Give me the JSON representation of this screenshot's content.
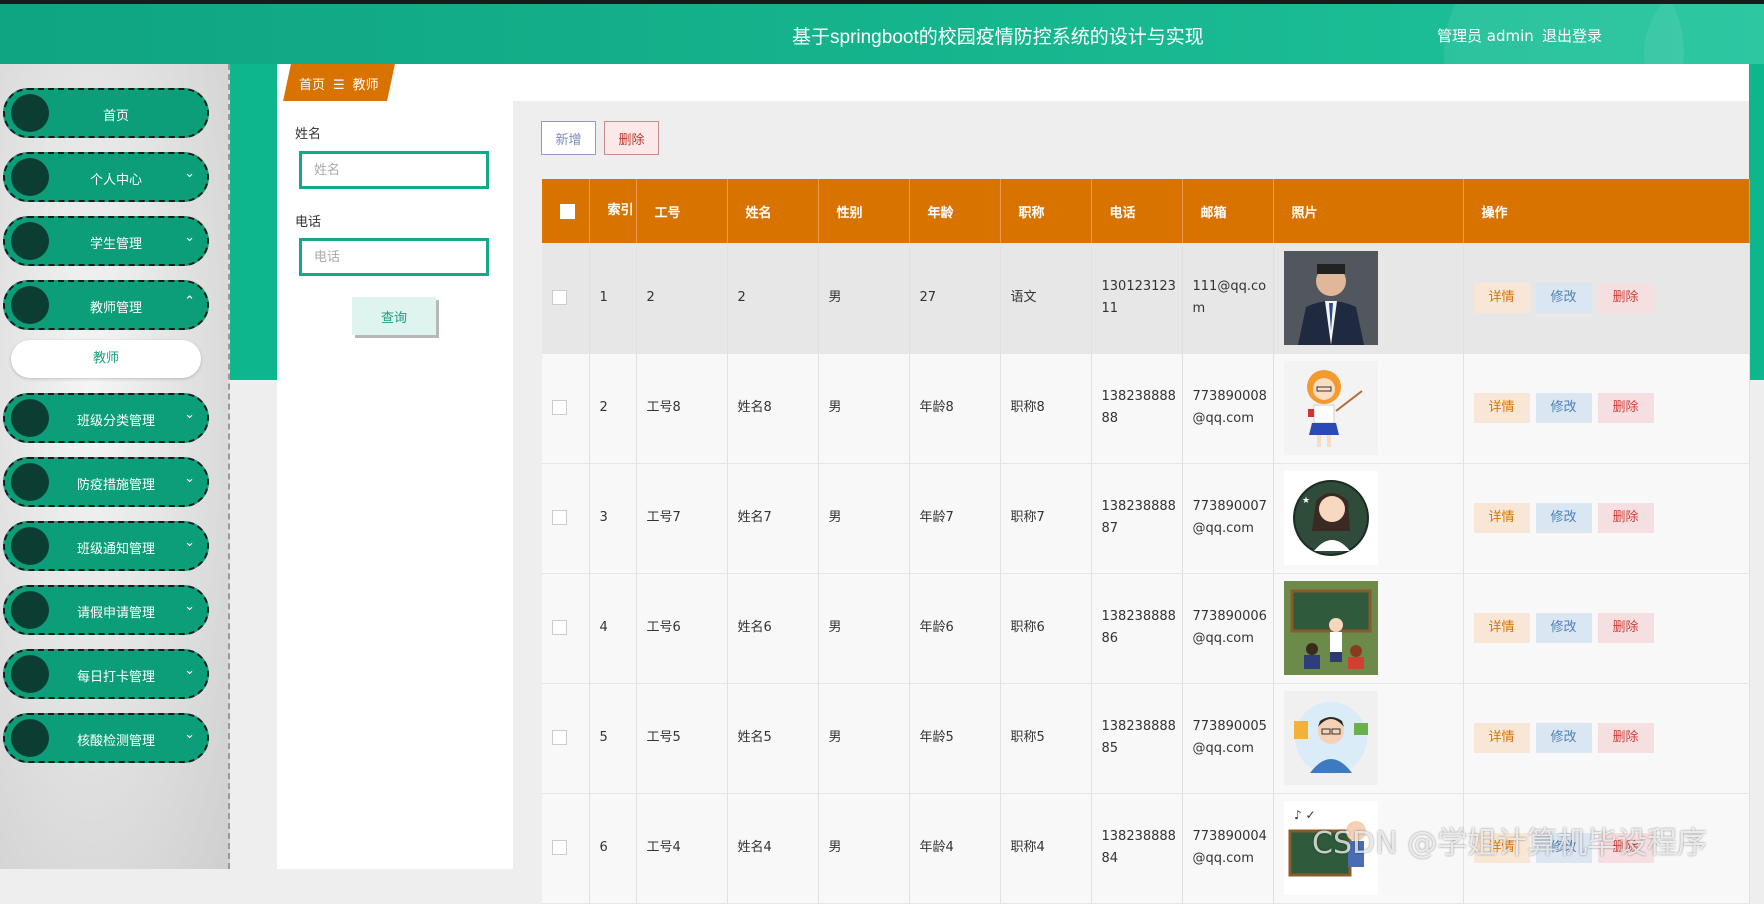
{
  "header": {
    "title": "基于springboot的校园疫情防控系统的设计与实现",
    "user": "管理员 admin",
    "logout": "退出登录"
  },
  "sidebar": {
    "items": [
      {
        "label": "首页",
        "has_chevron": false
      },
      {
        "label": "个人中心",
        "chevron": "⌄"
      },
      {
        "label": "学生管理",
        "chevron": "⌄"
      },
      {
        "label": "教师管理",
        "chevron": "⌃"
      },
      {
        "label": "班级分类管理",
        "chevron": "⌄"
      },
      {
        "label": "防疫措施管理",
        "chevron": "⌄"
      },
      {
        "label": "班级通知管理",
        "chevron": "⌄"
      },
      {
        "label": "请假申请管理",
        "chevron": "⌄"
      },
      {
        "label": "每日打卡管理",
        "chevron": "⌄"
      },
      {
        "label": "核酸检测管理",
        "chevron": "⌄"
      }
    ],
    "sub_item": "教师"
  },
  "breadcrumb": {
    "home": "首页",
    "separator": "☰",
    "current": "教师"
  },
  "search": {
    "name_label": "姓名",
    "name_placeholder": "姓名",
    "phone_label": "电话",
    "phone_placeholder": "电话",
    "query_button": "查询"
  },
  "toolbar": {
    "add": "新增",
    "delete": "删除"
  },
  "table": {
    "headers": [
      "索引",
      "工号",
      "姓名",
      "性别",
      "年龄",
      "职称",
      "电话",
      "邮箱",
      "照片",
      "操作"
    ],
    "actions": {
      "detail": "详情",
      "edit": "修改",
      "delete": "删除"
    },
    "rows": [
      {
        "index": "1",
        "id": "2",
        "name": "2",
        "gender": "男",
        "age": "27",
        "title": "语文",
        "phone": "13012312311",
        "email": "111@qq.com",
        "photo": "man-suit-photo"
      },
      {
        "index": "2",
        "id": "工号8",
        "name": "姓名8",
        "gender": "男",
        "age": "年龄8",
        "title": "职称8",
        "phone": "13823888888",
        "email": "773890008@qq.com",
        "photo": "cartoon-teacher-girl"
      },
      {
        "index": "3",
        "id": "工号7",
        "name": "姓名7",
        "gender": "男",
        "age": "年龄7",
        "title": "职称7",
        "phone": "13823888887",
        "email": "773890007@qq.com",
        "photo": "cartoon-teacher-round"
      },
      {
        "index": "4",
        "id": "工号6",
        "name": "姓名6",
        "gender": "男",
        "age": "年龄6",
        "title": "职称6",
        "phone": "13823888886",
        "email": "773890006@qq.com",
        "photo": "cartoon-classroom"
      },
      {
        "index": "5",
        "id": "工号5",
        "name": "姓名5",
        "gender": "男",
        "age": "年龄5",
        "title": "职称5",
        "phone": "13823888885",
        "email": "773890005@qq.com",
        "photo": "cartoon-teacher-books"
      },
      {
        "index": "6",
        "id": "工号4",
        "name": "姓名4",
        "gender": "男",
        "age": "年龄4",
        "title": "职称4",
        "phone": "13823888884",
        "email": "773890004@qq.com",
        "photo": "cartoon-blackboard"
      }
    ]
  },
  "watermark": "CSDN @学姐计算机毕设程序",
  "colors": {
    "brand_green": "#0db68c",
    "header_orange": "#d97300",
    "sidebar_pill": "#0c9e78"
  }
}
